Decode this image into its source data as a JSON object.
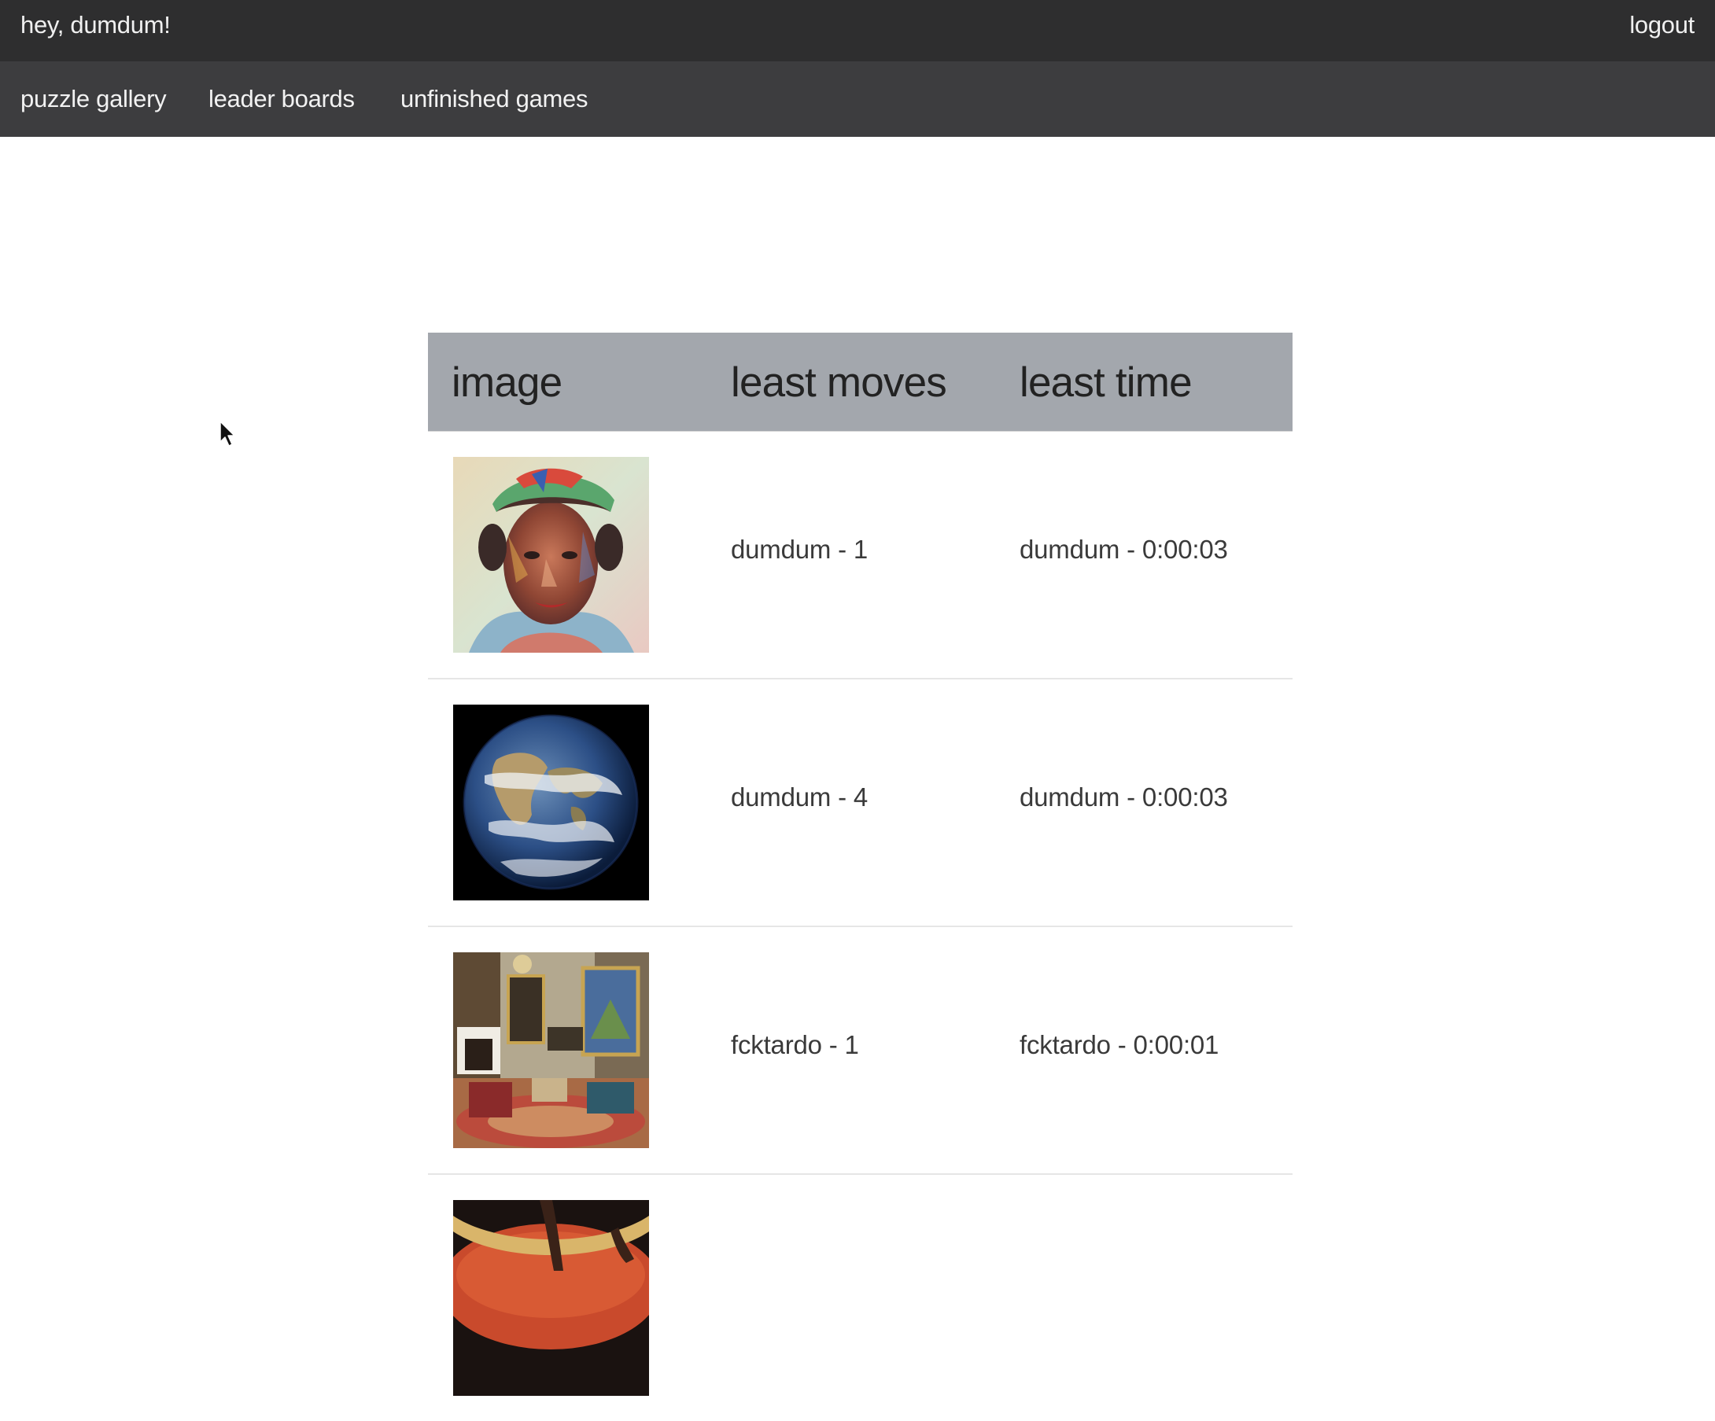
{
  "header": {
    "greeting": "hey, dumdum!",
    "logout_label": "logout"
  },
  "nav": {
    "items": [
      {
        "label": "puzzle gallery"
      },
      {
        "label": "leader boards"
      },
      {
        "label": "unfinished games"
      }
    ]
  },
  "leaderboard": {
    "columns": [
      "image",
      "least moves",
      "least time"
    ],
    "rows": [
      {
        "image": "portrait-painting",
        "least_moves": "dumdum - 1",
        "least_time": "dumdum - 0:00:03"
      },
      {
        "image": "earth-from-space",
        "least_moves": "dumdum - 4",
        "least_time": "dumdum - 0:00:03"
      },
      {
        "image": "ornate-room-interior",
        "least_moves": "fcktardo - 1",
        "least_time": "fcktardo - 0:00:01"
      },
      {
        "image": "red-bowl-hands",
        "least_moves": "",
        "least_time": ""
      }
    ]
  },
  "colors": {
    "topbar": "#2e2e2f",
    "navbar": "#3d3d3f",
    "table_header": "#a3a7ad"
  }
}
